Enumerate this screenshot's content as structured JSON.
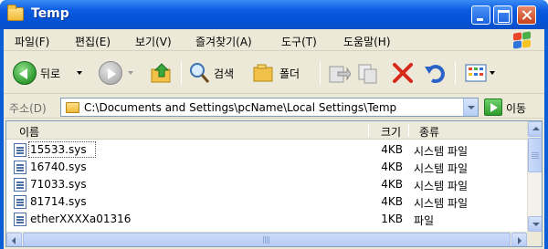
{
  "window": {
    "title": "Temp"
  },
  "menu": [
    "파일(F)",
    "편집(E)",
    "보기(V)",
    "즐겨찾기(A)",
    "도구(T)",
    "도움말(H)"
  ],
  "toolbar": {
    "back_label": "뒤로",
    "search_label": "검색",
    "folders_label": "폴더"
  },
  "address": {
    "label": "주소(D)",
    "path": "C:\\Documents and Settings\\pcName\\Local Settings\\Temp",
    "go_label": "이동"
  },
  "columns": {
    "name": "이름",
    "size": "크기",
    "type": "종류"
  },
  "files": [
    {
      "name": "15533.sys",
      "size": "4KB",
      "type": "시스템 파일"
    },
    {
      "name": "16740.sys",
      "size": "4KB",
      "type": "시스템 파일"
    },
    {
      "name": "71033.sys",
      "size": "4KB",
      "type": "시스템 파일"
    },
    {
      "name": "81714.sys",
      "size": "4KB",
      "type": "시스템 파일"
    },
    {
      "name": "etherXXXXa01316",
      "size": "1KB",
      "type": "파일"
    }
  ],
  "colors": {
    "title_bar": "#0a5fd8",
    "frame": "#ece9d8",
    "close_button": "#c9401c"
  }
}
